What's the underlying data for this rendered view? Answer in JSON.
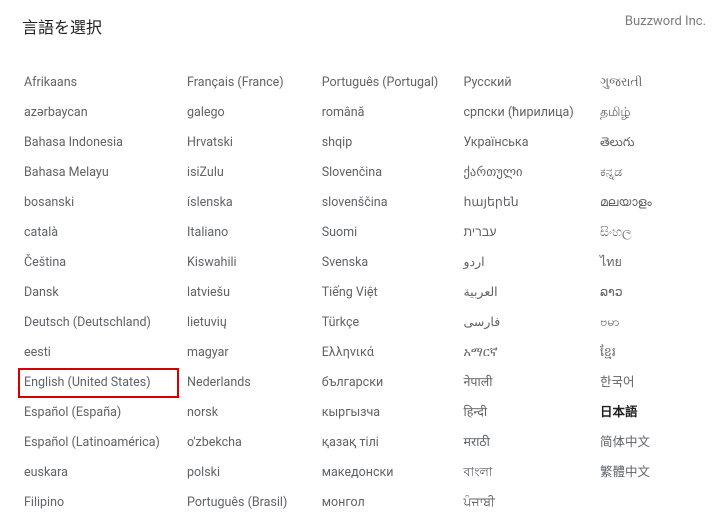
{
  "header": {
    "title": "言語を選択",
    "brand": "Buzzword Inc."
  },
  "highlighted": "English (United States)",
  "selected": "日本語",
  "columns": [
    [
      "Afrikaans",
      "azərbaycan",
      "Bahasa Indonesia",
      "Bahasa Melayu",
      "bosanski",
      "català",
      "Čeština",
      "Dansk",
      "Deutsch (Deutschland)",
      "eesti",
      "English (United States)",
      "Español (España)",
      "Español (Latinoamérica)",
      "euskara",
      "Filipino"
    ],
    [
      "Français (France)",
      "galego",
      "Hrvatski",
      "isiZulu",
      "íslenska",
      "Italiano",
      "Kiswahili",
      "latviešu",
      "lietuvių",
      "magyar",
      "Nederlands",
      "norsk",
      "o'zbekcha",
      "polski",
      "Português (Brasil)"
    ],
    [
      "Português (Portugal)",
      "română",
      "shqip",
      "Slovenčina",
      "slovenščina",
      "Suomi",
      "Svenska",
      "Tiếng Việt",
      "Türkçe",
      "Ελληνικά",
      "български",
      "кыргызча",
      "қазақ тілі",
      "македонски",
      "монгол"
    ],
    [
      "Русский",
      "српски (ћирилица)",
      "Українська",
      "ქართული",
      "հայերեն",
      "עברית",
      "اردو",
      "العربية",
      "فارسی",
      "አማርኛ",
      "नेपाली",
      "हिन्दी",
      "मराठी",
      "বাংলা",
      "ਪੰਜਾਬੀ"
    ],
    [
      "ગુજરાતી",
      "தமிழ்",
      "తెలుగు",
      "ಕನ್ನಡ",
      "മലയാളം",
      "සිංහල",
      "ไทย",
      "ລາວ",
      "ဗမာ",
      "ខ្មែរ",
      "한국어",
      "日本語",
      "简体中文",
      "繁體中文"
    ]
  ]
}
